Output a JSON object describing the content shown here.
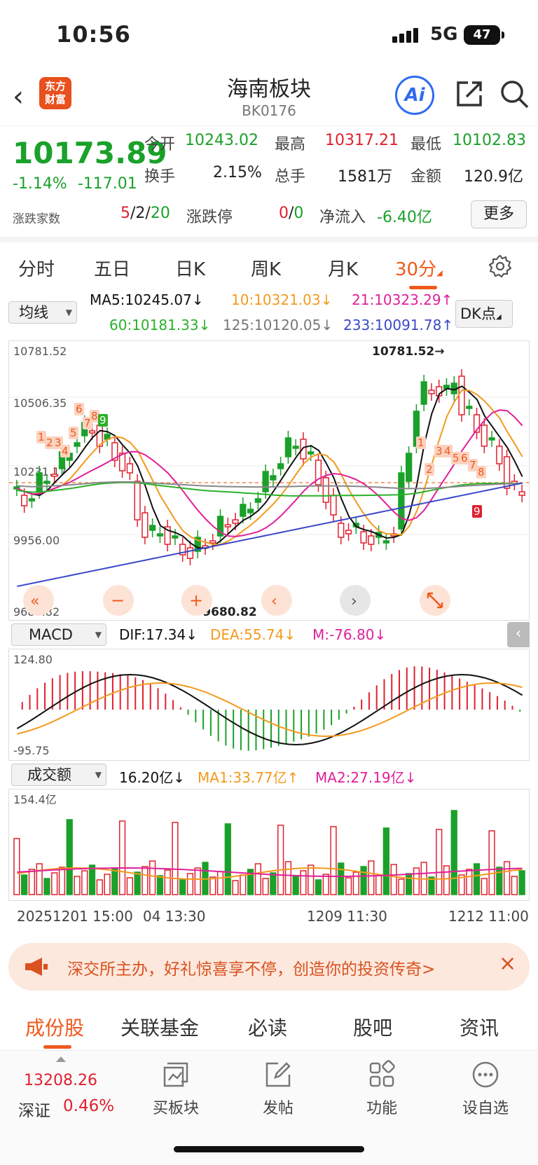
{
  "status": {
    "time": "10:56",
    "network": "5G",
    "battery": "47"
  },
  "header": {
    "logo_line1": "东方",
    "logo_line2": "财富",
    "title": "海南板块",
    "code": "BK0176",
    "ai_label": "Ai"
  },
  "quote": {
    "price": "10173.89",
    "change_pct": "-1.14%",
    "change_abs": "-117.01",
    "open_label": "今开",
    "open_value": "10243.02",
    "high_label": "最高",
    "high_value": "10317.21",
    "low_label": "最低",
    "low_value": "10102.83",
    "turnover_label": "换手",
    "turnover_value": "2.15%",
    "volume_label": "总手",
    "volume_value": "1581万",
    "amount_label": "金额",
    "amount_value": "120.9亿",
    "updown_label": "涨跌家数",
    "up_count": "5",
    "flat_count": "2",
    "down_count": "20",
    "limit_label": "涨跌停",
    "limit_up": "0",
    "limit_down": "0",
    "netflow_label": "净流入",
    "netflow_value": "-6.40亿",
    "more_label": "更多",
    "sep": "/"
  },
  "period_tabs": [
    "分时",
    "五日",
    "日K",
    "周K",
    "月K",
    "30分"
  ],
  "active_period": "30分",
  "ma_legend": {
    "selector": "均线",
    "ma5": "MA5:10245.07↓",
    "ma10": "10:10321.03↓",
    "ma21": "21:10323.29↑",
    "ma60": "60:10181.33↓",
    "ma125": "125:10120.05↓",
    "ma233": "233:10091.78↑",
    "dk": "DK点"
  },
  "colors": {
    "up": "#e0202e",
    "down": "#1aa12a",
    "ma5": "#111111",
    "ma10": "#f39a1e",
    "ma21": "#e0209a",
    "ma60": "#2ab12a",
    "ma125": "#888888",
    "ma233": "#3a48c8",
    "accent": "#ef5a1c"
  },
  "kline": {
    "ytop": "10781.52",
    "y2": "10506.35",
    "y3": "10231.17",
    "y4": "9956.00",
    "ybottom": "9680.82",
    "max_label": "10781.52→",
    "min_label": "←9680.82",
    "dk_top": [
      "1",
      "2",
      "3",
      "4",
      "5",
      "6",
      "7",
      "8",
      "9"
    ],
    "dk_bottom": [
      "1",
      "2",
      "3",
      "4",
      "5",
      "6",
      "7",
      "8",
      "9"
    ]
  },
  "macd": {
    "selector": "MACD",
    "dif": "DIF:17.34↓",
    "dea": "DEA:55.74↓",
    "m": "M:-76.80↓",
    "ytop": "124.80",
    "ybottom": "-95.75"
  },
  "volume": {
    "selector": "成交额",
    "value": "16.20亿↓",
    "ma1": "MA1:33.77亿↑",
    "ma2": "MA2:27.19亿↓",
    "ytop": "154.4亿"
  },
  "xaxis": [
    "20251201 15:00",
    "04 13:30",
    "1209 11:30",
    "1212 11:00"
  ],
  "banner": {
    "text": "深交所主办，好礼惊喜享不停，创造你的投资传奇>",
    "close": "×"
  },
  "bottom_tabs": [
    "成份股",
    "关联基金",
    "必读",
    "股吧",
    "资讯"
  ],
  "bottom_bar": {
    "index_value": "13208.26",
    "index_name": "深证",
    "index_pct": "0.46%",
    "items": [
      "买板块",
      "发帖",
      "功能",
      "设自选"
    ]
  }
}
